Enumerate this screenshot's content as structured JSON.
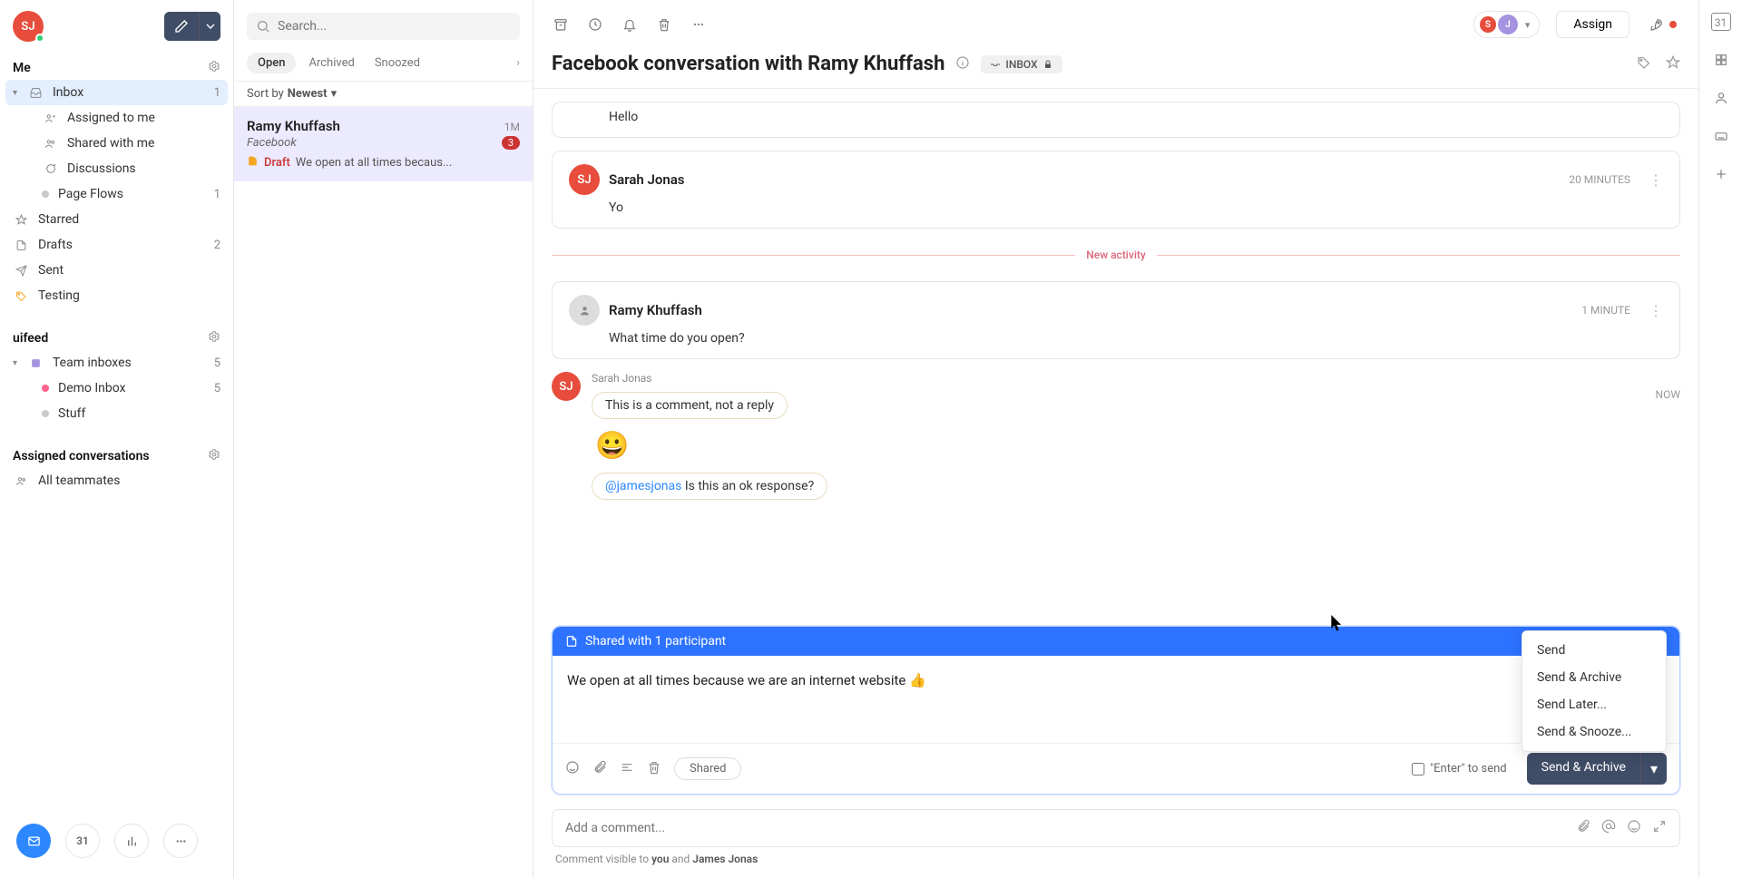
{
  "user": {
    "initials": "SJ"
  },
  "sidebar": {
    "sections": {
      "me": {
        "label": "Me"
      },
      "uifeed": {
        "label": "uifeed"
      },
      "assigned": {
        "label": "Assigned conversations"
      }
    },
    "inbox": {
      "label": "Inbox",
      "count": "1"
    },
    "assigned_to_me": {
      "label": "Assigned to me"
    },
    "shared_with_me": {
      "label": "Shared with me"
    },
    "discussions": {
      "label": "Discussions"
    },
    "page_flows": {
      "label": "Page Flows",
      "count": "1"
    },
    "starred": {
      "label": "Starred"
    },
    "drafts": {
      "label": "Drafts",
      "count": "2"
    },
    "sent": {
      "label": "Sent"
    },
    "testing": {
      "label": "Testing"
    },
    "team_inboxes": {
      "label": "Team inboxes",
      "count": "5"
    },
    "demo_inbox": {
      "label": "Demo Inbox",
      "count": "5"
    },
    "stuff": {
      "label": "Stuff"
    },
    "all_teammates": {
      "label": "All teammates"
    },
    "footer_cal": "31"
  },
  "list": {
    "search_placeholder": "Search...",
    "tabs": {
      "open": "Open",
      "archived": "Archived",
      "snoozed": "Snoozed"
    },
    "sort": {
      "prefix": "Sort by",
      "value": "Newest"
    },
    "item": {
      "name": "Ramy Khuffash",
      "time": "1M",
      "channel": "Facebook",
      "badge": "3",
      "draft_label": "Draft",
      "preview": "We open at all times becaus..."
    }
  },
  "conversation": {
    "title": "Facebook conversation with Ramy Khuffash",
    "inbox_tag": "INBOX",
    "assign_label": "Assign",
    "participants": {
      "p1": "S",
      "p2": "J"
    },
    "messages": {
      "m0": {
        "body": "Hello"
      },
      "m1": {
        "name": "Sarah Jonas",
        "initials": "SJ",
        "time": "20 MINUTES",
        "body": "Yo"
      },
      "activity_label": "New activity",
      "m2": {
        "name": "Ramy Khuffash",
        "time": "1 MINUTE",
        "body": "What time do you open?"
      },
      "note": {
        "author": "Sarah Jonas",
        "initials": "SJ",
        "time": "NOW",
        "line1": "This is a comment, not a reply",
        "emoji": "😀",
        "mention": "@jamesjonas",
        "line2_rest": " Is this an ok response?"
      }
    },
    "composer": {
      "header": "Shared with 1 participant",
      "body": "We open at all times because we are an internet website 👍",
      "shared_pill": "Shared",
      "enter_to_send": "\"Enter\" to send",
      "send_button": "Send & Archive",
      "menu": {
        "send": "Send",
        "send_archive": "Send & Archive",
        "send_later": "Send Later...",
        "send_snooze": "Send & Snooze..."
      }
    },
    "comment_placeholder": "Add a comment...",
    "visibility": {
      "prefix": "Comment visible to ",
      "you": "you",
      "and": " and ",
      "other": "James Jonas"
    }
  },
  "rail": {
    "calendar_day": "31"
  }
}
